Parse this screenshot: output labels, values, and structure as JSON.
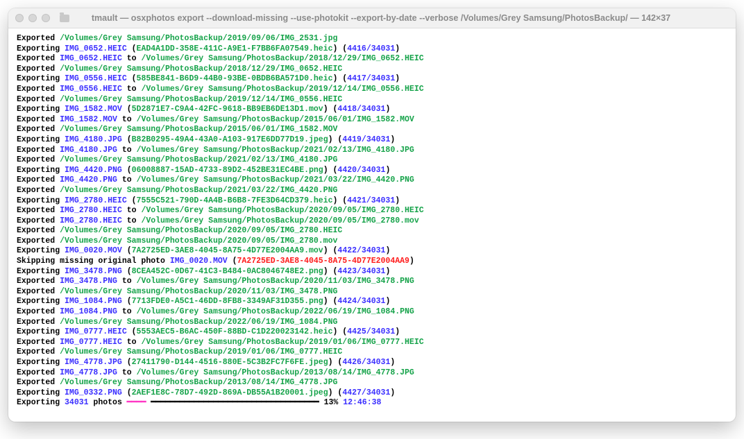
{
  "title": "tmault — osxphotos export --download-missing --use-photokit --export-by-date --verbose /Volumes/Grey Samsung/PhotosBackup/ — 142×37",
  "lines": [
    [
      [
        "plain",
        "Exported "
      ],
      [
        "green",
        "/Volumes/Grey Samsung/PhotosBackup/2019/09/06/IMG_2531.jpg"
      ]
    ],
    [
      [
        "plain",
        "Exporting "
      ],
      [
        "blue",
        "IMG_0652.HEIC"
      ],
      [
        "plain",
        " ("
      ],
      [
        "green",
        "EAD4A1DD-358E-411C-A9E1-F7BB6FA07549.heic"
      ],
      [
        "plain",
        ") ("
      ],
      [
        "blue",
        "4416/34031"
      ],
      [
        "plain",
        ")"
      ]
    ],
    [
      [
        "plain",
        "Exported "
      ],
      [
        "blue",
        "IMG_0652.HEIC"
      ],
      [
        "plain",
        " to "
      ],
      [
        "green",
        "/Volumes/Grey Samsung/PhotosBackup/2018/12/29/IMG_0652.HEIC"
      ]
    ],
    [
      [
        "plain",
        "Exported "
      ],
      [
        "green",
        "/Volumes/Grey Samsung/PhotosBackup/2018/12/29/IMG_0652.HEIC"
      ]
    ],
    [
      [
        "plain",
        "Exporting "
      ],
      [
        "blue",
        "IMG_0556.HEIC"
      ],
      [
        "plain",
        " ("
      ],
      [
        "green",
        "585BE841-B6D9-44B0-93BE-0BDB6BA571D0.heic"
      ],
      [
        "plain",
        ") ("
      ],
      [
        "blue",
        "4417/34031"
      ],
      [
        "plain",
        ")"
      ]
    ],
    [
      [
        "plain",
        "Exported "
      ],
      [
        "blue",
        "IMG_0556.HEIC"
      ],
      [
        "plain",
        " to "
      ],
      [
        "green",
        "/Volumes/Grey Samsung/PhotosBackup/2019/12/14/IMG_0556.HEIC"
      ]
    ],
    [
      [
        "plain",
        "Exported "
      ],
      [
        "green",
        "/Volumes/Grey Samsung/PhotosBackup/2019/12/14/IMG_0556.HEIC"
      ]
    ],
    [
      [
        "plain",
        "Exporting "
      ],
      [
        "blue",
        "IMG_1582.MOV"
      ],
      [
        "plain",
        " ("
      ],
      [
        "green",
        "5D2871E7-C9A4-42FC-9618-BB9EB6DE13D1.mov"
      ],
      [
        "plain",
        ") ("
      ],
      [
        "blue",
        "4418/34031"
      ],
      [
        "plain",
        ")"
      ]
    ],
    [
      [
        "plain",
        "Exported "
      ],
      [
        "blue",
        "IMG_1582.MOV"
      ],
      [
        "plain",
        " to "
      ],
      [
        "green",
        "/Volumes/Grey Samsung/PhotosBackup/2015/06/01/IMG_1582.MOV"
      ]
    ],
    [
      [
        "plain",
        "Exported "
      ],
      [
        "green",
        "/Volumes/Grey Samsung/PhotosBackup/2015/06/01/IMG_1582.MOV"
      ]
    ],
    [
      [
        "plain",
        "Exporting "
      ],
      [
        "blue",
        "IMG_4180.JPG"
      ],
      [
        "plain",
        " ("
      ],
      [
        "green",
        "B82B0295-49A4-43A0-A103-917E6DD77D19.jpeg"
      ],
      [
        "plain",
        ") ("
      ],
      [
        "blue",
        "4419/34031"
      ],
      [
        "plain",
        ")"
      ]
    ],
    [
      [
        "plain",
        "Exported "
      ],
      [
        "blue",
        "IMG_4180.JPG"
      ],
      [
        "plain",
        " to "
      ],
      [
        "green",
        "/Volumes/Grey Samsung/PhotosBackup/2021/02/13/IMG_4180.JPG"
      ]
    ],
    [
      [
        "plain",
        "Exported "
      ],
      [
        "green",
        "/Volumes/Grey Samsung/PhotosBackup/2021/02/13/IMG_4180.JPG"
      ]
    ],
    [
      [
        "plain",
        "Exporting "
      ],
      [
        "blue",
        "IMG_4420.PNG"
      ],
      [
        "plain",
        " ("
      ],
      [
        "green",
        "06008887-15AD-4733-89D2-452BE31EC4BE.png"
      ],
      [
        "plain",
        ") ("
      ],
      [
        "blue",
        "4420/34031"
      ],
      [
        "plain",
        ")"
      ]
    ],
    [
      [
        "plain",
        "Exported "
      ],
      [
        "blue",
        "IMG_4420.PNG"
      ],
      [
        "plain",
        " to "
      ],
      [
        "green",
        "/Volumes/Grey Samsung/PhotosBackup/2021/03/22/IMG_4420.PNG"
      ]
    ],
    [
      [
        "plain",
        "Exported "
      ],
      [
        "green",
        "/Volumes/Grey Samsung/PhotosBackup/2021/03/22/IMG_4420.PNG"
      ]
    ],
    [
      [
        "plain",
        "Exporting "
      ],
      [
        "blue",
        "IMG_2780.HEIC"
      ],
      [
        "plain",
        " ("
      ],
      [
        "green",
        "7555C521-790D-4A4B-B6B8-7FE3D64CD379.heic"
      ],
      [
        "plain",
        ") ("
      ],
      [
        "blue",
        "4421/34031"
      ],
      [
        "plain",
        ")"
      ]
    ],
    [
      [
        "plain",
        "Exported "
      ],
      [
        "blue",
        "IMG_2780.HEIC"
      ],
      [
        "plain",
        " to "
      ],
      [
        "green",
        "/Volumes/Grey Samsung/PhotosBackup/2020/09/05/IMG_2780.HEIC"
      ]
    ],
    [
      [
        "plain",
        "Exported "
      ],
      [
        "blue",
        "IMG_2780.HEIC"
      ],
      [
        "plain",
        " to "
      ],
      [
        "green",
        "/Volumes/Grey Samsung/PhotosBackup/2020/09/05/IMG_2780.mov"
      ]
    ],
    [
      [
        "plain",
        "Exported "
      ],
      [
        "green",
        "/Volumes/Grey Samsung/PhotosBackup/2020/09/05/IMG_2780.HEIC"
      ]
    ],
    [
      [
        "plain",
        "Exported "
      ],
      [
        "green",
        "/Volumes/Grey Samsung/PhotosBackup/2020/09/05/IMG_2780.mov"
      ]
    ],
    [
      [
        "plain",
        "Exporting "
      ],
      [
        "blue",
        "IMG_0020.MOV"
      ],
      [
        "plain",
        " ("
      ],
      [
        "green",
        "7A2725ED-3AE8-4045-8A75-4D77E2004AA9.mov"
      ],
      [
        "plain",
        ") ("
      ],
      [
        "blue",
        "4422/34031"
      ],
      [
        "plain",
        ")"
      ]
    ],
    [
      [
        "plain",
        "Skipping missing original photo "
      ],
      [
        "blue",
        "IMG_0020.MOV"
      ],
      [
        "plain",
        " ("
      ],
      [
        "red",
        "7A2725ED-3AE8-4045-8A75-4D77E2004AA9"
      ],
      [
        "plain",
        ")"
      ]
    ],
    [
      [
        "plain",
        "Exporting "
      ],
      [
        "blue",
        "IMG_3478.PNG"
      ],
      [
        "plain",
        " ("
      ],
      [
        "green",
        "8CEA452C-0D67-41C3-B484-0AC8046748E2.png"
      ],
      [
        "plain",
        ") ("
      ],
      [
        "blue",
        "4423/34031"
      ],
      [
        "plain",
        ")"
      ]
    ],
    [
      [
        "plain",
        "Exported "
      ],
      [
        "blue",
        "IMG_3478.PNG"
      ],
      [
        "plain",
        " to "
      ],
      [
        "green",
        "/Volumes/Grey Samsung/PhotosBackup/2020/11/03/IMG_3478.PNG"
      ]
    ],
    [
      [
        "plain",
        "Exported "
      ],
      [
        "green",
        "/Volumes/Grey Samsung/PhotosBackup/2020/11/03/IMG_3478.PNG"
      ]
    ],
    [
      [
        "plain",
        "Exporting "
      ],
      [
        "blue",
        "IMG_1084.PNG"
      ],
      [
        "plain",
        " ("
      ],
      [
        "green",
        "7713FDE0-A5C1-46DD-8FB8-3349AF31D355.png"
      ],
      [
        "plain",
        ") ("
      ],
      [
        "blue",
        "4424/34031"
      ],
      [
        "plain",
        ")"
      ]
    ],
    [
      [
        "plain",
        "Exported "
      ],
      [
        "blue",
        "IMG_1084.PNG"
      ],
      [
        "plain",
        " to "
      ],
      [
        "green",
        "/Volumes/Grey Samsung/PhotosBackup/2022/06/19/IMG_1084.PNG"
      ]
    ],
    [
      [
        "plain",
        "Exported "
      ],
      [
        "green",
        "/Volumes/Grey Samsung/PhotosBackup/2022/06/19/IMG_1084.PNG"
      ]
    ],
    [
      [
        "plain",
        "Exporting "
      ],
      [
        "blue",
        "IMG_0777.HEIC"
      ],
      [
        "plain",
        " ("
      ],
      [
        "green",
        "5553AEC5-B6AC-450F-88BD-C1D220023142.heic"
      ],
      [
        "plain",
        ") ("
      ],
      [
        "blue",
        "4425/34031"
      ],
      [
        "plain",
        ")"
      ]
    ],
    [
      [
        "plain",
        "Exported "
      ],
      [
        "blue",
        "IMG_0777.HEIC"
      ],
      [
        "plain",
        " to "
      ],
      [
        "green",
        "/Volumes/Grey Samsung/PhotosBackup/2019/01/06/IMG_0777.HEIC"
      ]
    ],
    [
      [
        "plain",
        "Exported "
      ],
      [
        "green",
        "/Volumes/Grey Samsung/PhotosBackup/2019/01/06/IMG_0777.HEIC"
      ]
    ],
    [
      [
        "plain",
        "Exporting "
      ],
      [
        "blue",
        "IMG_4778.JPG"
      ],
      [
        "plain",
        " ("
      ],
      [
        "green",
        "27411790-D144-4516-880E-5C3B2FC7F6FE.jpeg"
      ],
      [
        "plain",
        ") ("
      ],
      [
        "blue",
        "4426/34031"
      ],
      [
        "plain",
        ")"
      ]
    ],
    [
      [
        "plain",
        "Exported "
      ],
      [
        "blue",
        "IMG_4778.JPG"
      ],
      [
        "plain",
        " to "
      ],
      [
        "green",
        "/Volumes/Grey Samsung/PhotosBackup/2013/08/14/IMG_4778.JPG"
      ]
    ],
    [
      [
        "plain",
        "Exported "
      ],
      [
        "green",
        "/Volumes/Grey Samsung/PhotosBackup/2013/08/14/IMG_4778.JPG"
      ]
    ],
    [
      [
        "plain",
        "Exporting "
      ],
      [
        "blue",
        "IMG_0332.PNG"
      ],
      [
        "plain",
        " ("
      ],
      [
        "green",
        "2AEF1E8C-78D7-492D-869A-DB55A1B20001.jpeg"
      ],
      [
        "plain",
        ") ("
      ],
      [
        "blue",
        "4427/34031"
      ],
      [
        "plain",
        ")"
      ]
    ]
  ],
  "progress": {
    "prefix": "Exporting ",
    "count": "34031",
    "photos_word": " photos ",
    "filled": "━━━━",
    "rest": " ━━━━━━━━━━━━━━━━━━━━━━━━━━━━━━━━━━━",
    "percent": " 13% ",
    "eta": "12:46:38"
  }
}
